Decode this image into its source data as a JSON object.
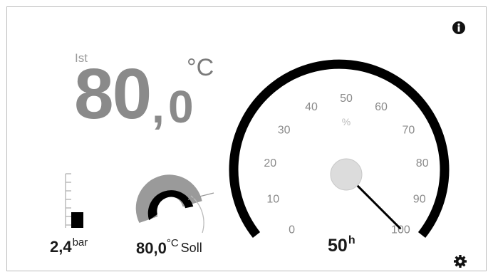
{
  "actual": {
    "label": "Ist",
    "value_int": "80",
    "comma": ",",
    "value_dec": "0",
    "unit": "°C"
  },
  "pressure": {
    "value": "2,4",
    "unit": "bar",
    "level": 0.35
  },
  "setpoint": {
    "value": "80,0",
    "unit": "°C",
    "label": "Soll",
    "level": 0.5
  },
  "gauge": {
    "ticks": [
      "0",
      "10",
      "20",
      "30",
      "40",
      "50",
      "60",
      "70",
      "80",
      "90",
      "100"
    ],
    "unit_label": "%",
    "needle_value": 100,
    "hours_value": "50",
    "hours_unit": "h"
  },
  "icons": {
    "info": "info-icon",
    "settings": "gear-icon"
  },
  "colors": {
    "text_dark": "#1a1a1a",
    "temp_gray": "#8a8a8a",
    "arc": "#000000",
    "hub": "#dcdcdc"
  }
}
